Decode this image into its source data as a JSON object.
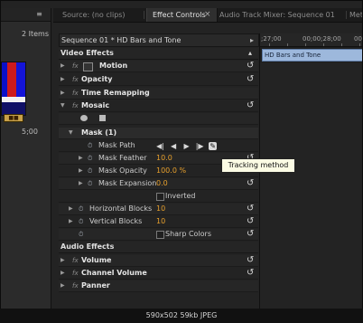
{
  "left_panel": {
    "items_count": "2 Items",
    "menu_icon": "panel-menu-icon",
    "timecode": "5;00"
  },
  "tabs": {
    "source": "Source: (no clips)",
    "effect_controls": "Effect Controls",
    "close": "×",
    "audio_mixer": "Audio Track Mixer: Sequence 01",
    "metadata": "Met"
  },
  "effect_controls": {
    "header": "Sequence 01 * HD Bars and Tone",
    "header_arrow": "▸",
    "sections": {
      "video_effects": "Video Effects",
      "audio_effects": "Audio Effects"
    },
    "rows": {
      "motion": "Motion",
      "opacity": "Opacity",
      "time_remapping": "Time Remapping",
      "mosaic": "Mosaic",
      "mask": "Mask (1)",
      "mask_path": "Mask Path",
      "mask_feather": "Mask Feather",
      "mask_feather_value": "10.0",
      "mask_opacity": "Mask Opacity",
      "mask_opacity_value": "100.0 %",
      "mask_expansion": "Mask Expansion",
      "mask_expansion_value": "0.0",
      "inverted": "Inverted",
      "horizontal_blocks": "Horizontal Blocks",
      "horizontal_blocks_value": "10",
      "vertical_blocks": "Vertical Blocks",
      "vertical_blocks_value": "10",
      "sharp_colors": "Sharp Colors",
      "volume": "Volume",
      "channel_volume": "Channel Volume",
      "panner": "Panner"
    },
    "fx_label": "fx",
    "reset_glyph": "↺",
    "mask_controls": [
      "◀|",
      "◀",
      "▶",
      "|▶"
    ],
    "tracking_tool": "🔧"
  },
  "tooltip": "Tracking method",
  "timeline": {
    "ruler_labels": [
      ";27;00",
      "00;00;28;00",
      "00"
    ],
    "clip_label": "HD Bars and Tone"
  },
  "caption": "590x502  59kb  JPEG",
  "colors": {
    "value_orange": "#e7a02d",
    "clip_blue": "#9db8dc",
    "tooltip_bg": "#fbfbe4"
  }
}
